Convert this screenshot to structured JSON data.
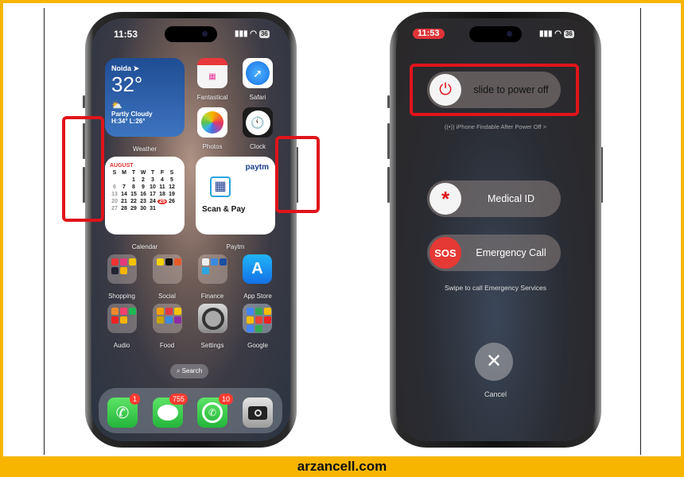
{
  "footer": {
    "site": "arzancell.com"
  },
  "left_phone": {
    "status": {
      "time": "11:53",
      "battery": "36"
    },
    "weather": {
      "city": "Noida",
      "temp": "32°",
      "condition": "Partly Cloudy",
      "range": "H:34° L:26°",
      "label": "Weather"
    },
    "apps": [
      {
        "label": "Fantastical"
      },
      {
        "label": "Safari"
      },
      {
        "label": "Photos"
      },
      {
        "label": "Clock"
      }
    ],
    "calendar": {
      "month": "AUGUST",
      "days": [
        "S",
        "M",
        "T",
        "W",
        "T",
        "F",
        "S"
      ],
      "dates": [
        "",
        "",
        "1",
        "2",
        "3",
        "4",
        "5",
        "6",
        "7",
        "8",
        "9",
        "10",
        "11",
        "12",
        "13",
        "14",
        "15",
        "16",
        "17",
        "18",
        "19",
        "20",
        "21",
        "22",
        "23",
        "24",
        "25",
        "26",
        "27",
        "28",
        "29",
        "30",
        "31",
        "",
        ""
      ],
      "today": "25",
      "label": "Calendar"
    },
    "paytm": {
      "brand": "paytm",
      "action": "Scan & Pay",
      "label": "Paytm"
    },
    "row1": [
      {
        "label": "Shopping"
      },
      {
        "label": "Social"
      },
      {
        "label": "Finance"
      },
      {
        "label": "App Store"
      }
    ],
    "row2": [
      {
        "label": "Audio"
      },
      {
        "label": "Food"
      },
      {
        "label": "Settings"
      },
      {
        "label": "Google"
      }
    ],
    "search": "Search",
    "dock": [
      {
        "name": "Phone",
        "badge": "1"
      },
      {
        "name": "Messages",
        "badge": "755"
      },
      {
        "name": "WhatsApp",
        "badge": "10"
      },
      {
        "name": "Camera",
        "badge": ""
      }
    ]
  },
  "right_phone": {
    "status": {
      "time": "11:53",
      "battery": "36"
    },
    "power_slider": "slide to power off",
    "findable": "((•)) iPhone Findable After Power Off >",
    "medical_slider": "Medical ID",
    "sos_knob": "SOS",
    "sos_slider": "Emergency Call",
    "sos_hint": "Swipe to call Emergency Services",
    "cancel": "Cancel"
  },
  "colors": {
    "highlight": "#e0141b",
    "frame": "#f7b500"
  }
}
